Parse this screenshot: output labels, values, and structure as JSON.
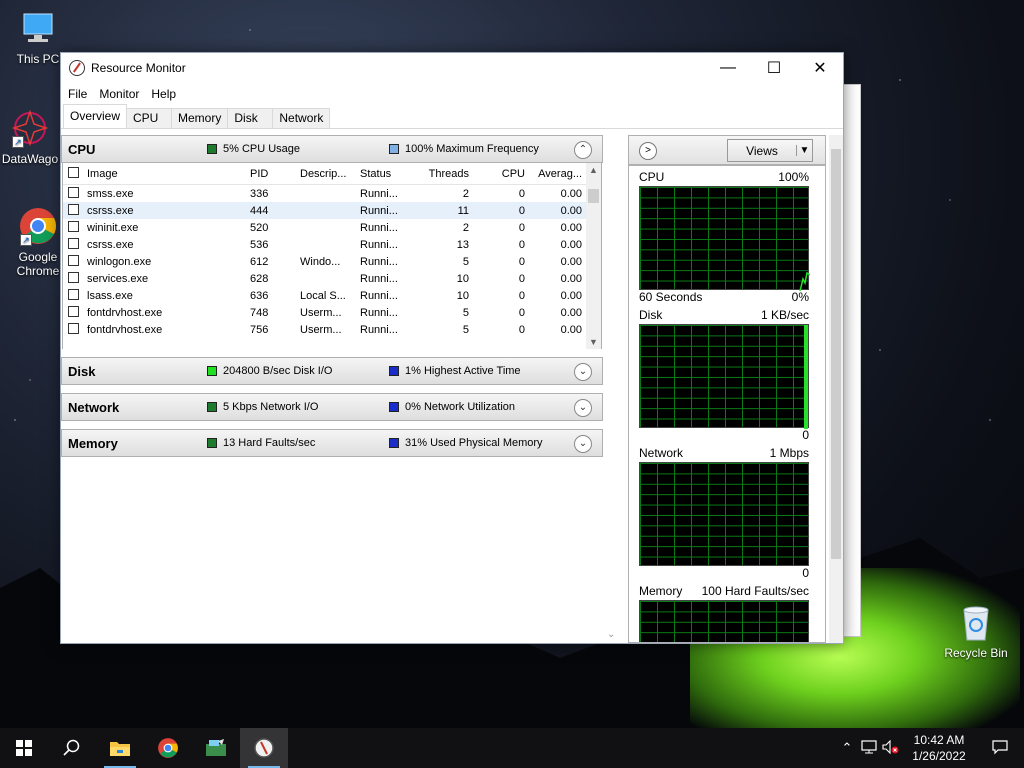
{
  "desktop": {
    "icons": [
      {
        "label": "This PC",
        "icon": "this-pc-icon"
      },
      {
        "label": "DataWago",
        "icon": "datawago-icon"
      },
      {
        "label": "Google Chrome",
        "icon": "chrome-icon"
      },
      {
        "label": "Recycle Bin",
        "icon": "recycle-bin-icon"
      }
    ]
  },
  "window": {
    "title": "Resource Monitor",
    "controls": {
      "minimize": "—",
      "maximize": "☐",
      "close": "✕"
    },
    "menu": [
      "File",
      "Monitor",
      "Help"
    ],
    "tabs": [
      "Overview",
      "CPU",
      "Memory",
      "Disk",
      "Network"
    ],
    "active_tab": "Overview"
  },
  "sections": {
    "cpu": {
      "name": "CPU",
      "ind1": "5% CPU Usage",
      "ind1_color": "#1e7a2e",
      "ind2": "100% Maximum Frequency",
      "ind2_color": "#7fb1e6",
      "chevron": "⌃"
    },
    "disk": {
      "name": "Disk",
      "ind1": "204800 B/sec Disk I/O",
      "ind1_color": "#21e021",
      "ind2": "1% Highest Active Time",
      "ind2_color": "#1a2dc9",
      "chevron": "⌄"
    },
    "network": {
      "name": "Network",
      "ind1": "5 Kbps Network I/O",
      "ind1_color": "#1e7a2e",
      "ind2": "0% Network Utilization",
      "ind2_color": "#1a2dc9",
      "chevron": "⌄"
    },
    "memory": {
      "name": "Memory",
      "ind1": "13 Hard Faults/sec",
      "ind1_color": "#1e7a2e",
      "ind2": "31% Used Physical Memory",
      "ind2_color": "#1a2dc9",
      "chevron": "⌄"
    }
  },
  "process_table": {
    "columns": [
      "Image",
      "PID",
      "Descrip...",
      "Status",
      "Threads",
      "CPU",
      "Averag..."
    ],
    "sort_indicator": "^",
    "rows": [
      {
        "image": "smss.exe",
        "pid": "336",
        "desc": "",
        "status": "Runni...",
        "threads": "2",
        "cpu": "0",
        "avg": "0.00"
      },
      {
        "image": "csrss.exe",
        "pid": "444",
        "desc": "",
        "status": "Runni...",
        "threads": "11",
        "cpu": "0",
        "avg": "0.00"
      },
      {
        "image": "wininit.exe",
        "pid": "520",
        "desc": "",
        "status": "Runni...",
        "threads": "2",
        "cpu": "0",
        "avg": "0.00"
      },
      {
        "image": "csrss.exe",
        "pid": "536",
        "desc": "",
        "status": "Runni...",
        "threads": "13",
        "cpu": "0",
        "avg": "0.00"
      },
      {
        "image": "winlogon.exe",
        "pid": "612",
        "desc": "Windo...",
        "status": "Runni...",
        "threads": "5",
        "cpu": "0",
        "avg": "0.00"
      },
      {
        "image": "services.exe",
        "pid": "628",
        "desc": "",
        "status": "Runni...",
        "threads": "10",
        "cpu": "0",
        "avg": "0.00"
      },
      {
        "image": "lsass.exe",
        "pid": "636",
        "desc": "Local S...",
        "status": "Runni...",
        "threads": "10",
        "cpu": "0",
        "avg": "0.00"
      },
      {
        "image": "fontdrvhost.exe",
        "pid": "748",
        "desc": "Userm...",
        "status": "Runni...",
        "threads": "5",
        "cpu": "0",
        "avg": "0.00"
      },
      {
        "image": "fontdrvhost.exe",
        "pid": "756",
        "desc": "Userm...",
        "status": "Runni...",
        "threads": "5",
        "cpu": "0",
        "avg": "0.00"
      }
    ]
  },
  "graph_panel": {
    "views_label": "Views",
    "graphs": [
      {
        "name": "CPU",
        "max": "100%",
        "foot_left": "60 Seconds",
        "foot_right": "0%"
      },
      {
        "name": "Disk",
        "max": "1 KB/sec",
        "foot_left": "",
        "foot_right": "0"
      },
      {
        "name": "Network",
        "max": "1 Mbps",
        "foot_left": "",
        "foot_right": "0"
      },
      {
        "name": "Memory",
        "max": "100 Hard Faults/sec",
        "foot_left": "",
        "foot_right": ""
      }
    ]
  },
  "taskbar": {
    "apps": [
      "start-icon",
      "search-icon",
      "file-explorer-icon",
      "chrome-icon",
      "datawago-icon",
      "resource-monitor-icon"
    ],
    "time": "10:42 AM",
    "date": "1/26/2022"
  }
}
